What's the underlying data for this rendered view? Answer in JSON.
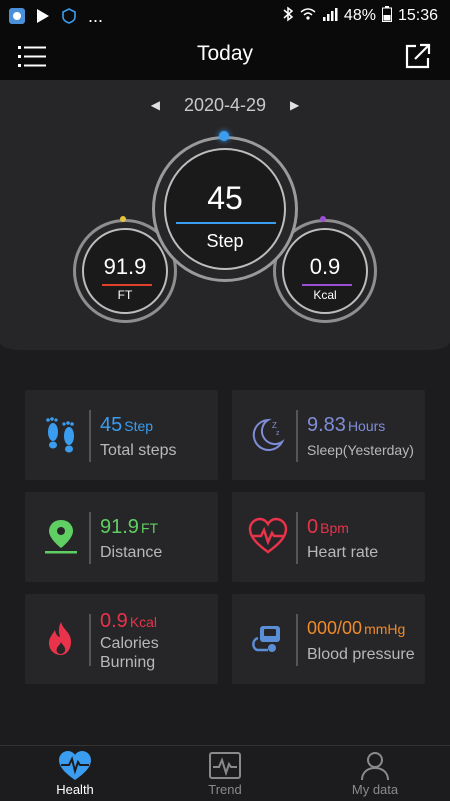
{
  "status_bar": {
    "dots": "...",
    "battery": "48%",
    "time": "15:36"
  },
  "app_bar": {
    "title": "Today"
  },
  "date_nav": {
    "date": "2020-4-29"
  },
  "rings": {
    "center": {
      "value": "45",
      "label": "Step",
      "color": "#3a9df0"
    },
    "left": {
      "value": "91.9",
      "label": "FT",
      "color": "#e0402a"
    },
    "right": {
      "value": "0.9",
      "label": "Kcal",
      "color": "#9b4fd6"
    }
  },
  "cards": {
    "steps": {
      "value": "45",
      "unit": "Step",
      "label": "Total steps",
      "color": "#3a9df0",
      "icon": "footprints-icon"
    },
    "sleep": {
      "value": "9.83",
      "unit": "Hours",
      "label": "Sleep(Yesterday)",
      "color": "#7f8dd8",
      "icon": "moon-zzz-icon"
    },
    "distance": {
      "value": "91.9",
      "unit": "FT",
      "label": "Distance",
      "color": "#5fcf63",
      "icon": "location-pin-icon"
    },
    "heart": {
      "value": "0",
      "unit": "Bpm",
      "label": "Heart rate",
      "color": "#e8334a",
      "icon": "heart-pulse-icon"
    },
    "calories": {
      "value": "0.9",
      "unit": "Kcal",
      "label_line1": "Calories",
      "label_line2": "Burning",
      "color": "#e8334a",
      "icon": "flame-icon"
    },
    "blood_pressure": {
      "value": "000/00",
      "unit": "mmHg",
      "label": "Blood pressure",
      "color": "#f08a2a",
      "icon": "blood-pressure-cuff-icon"
    }
  },
  "bottom_nav": {
    "items": [
      {
        "label": "Health",
        "active": true
      },
      {
        "label": "Trend",
        "active": false
      },
      {
        "label": "My data",
        "active": false
      }
    ]
  }
}
